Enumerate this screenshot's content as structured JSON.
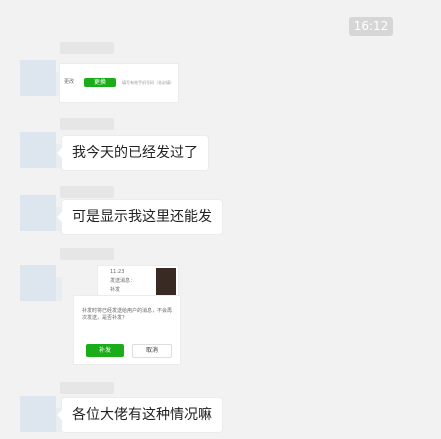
{
  "timestamp": "16:12",
  "messages": [
    {
      "type": "image",
      "caption_left": "更改",
      "button": "更换",
      "hint": "填写有效手机号码（非必填）"
    },
    {
      "type": "text",
      "text": "我今天的已经发过了"
    },
    {
      "type": "text",
      "text": "可是显示我这里还能发"
    },
    {
      "type": "image",
      "time": "11:23",
      "line1": "发送消息：",
      "line2": "补发",
      "dialog_text": "补发时将已经发送给用户的消息，不会再次发送，是否补发？",
      "confirm_label": "补发",
      "cancel_label": "取消"
    },
    {
      "type": "text",
      "text": "各位大佬有这种情况嘛"
    }
  ]
}
